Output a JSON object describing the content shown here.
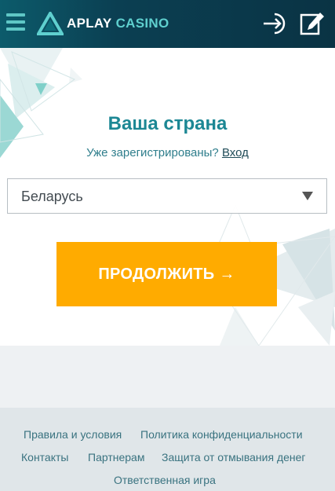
{
  "header": {
    "logo_primary": "APLAY",
    "logo_secondary": "CASINO",
    "icons": [
      "menu-icon",
      "login-icon",
      "register-icon"
    ],
    "colors": {
      "background": "#0b3f52",
      "accent": "#5fd0cf"
    }
  },
  "form": {
    "title": "Ваша страна",
    "already_registered": "Уже зарегистрированы?",
    "login_link": "Вход",
    "country_selected": "Беларусь",
    "continue_label": "ПРОДОЛЖИТЬ →",
    "colors": {
      "title": "#1c8794",
      "button": "#ffab00"
    }
  },
  "footer": {
    "links": [
      "Правила и условия",
      "Политика конфиденциальности",
      "Контакты",
      "Партнерам",
      "Защита от отмывания денег",
      "Ответственная игра"
    ]
  }
}
